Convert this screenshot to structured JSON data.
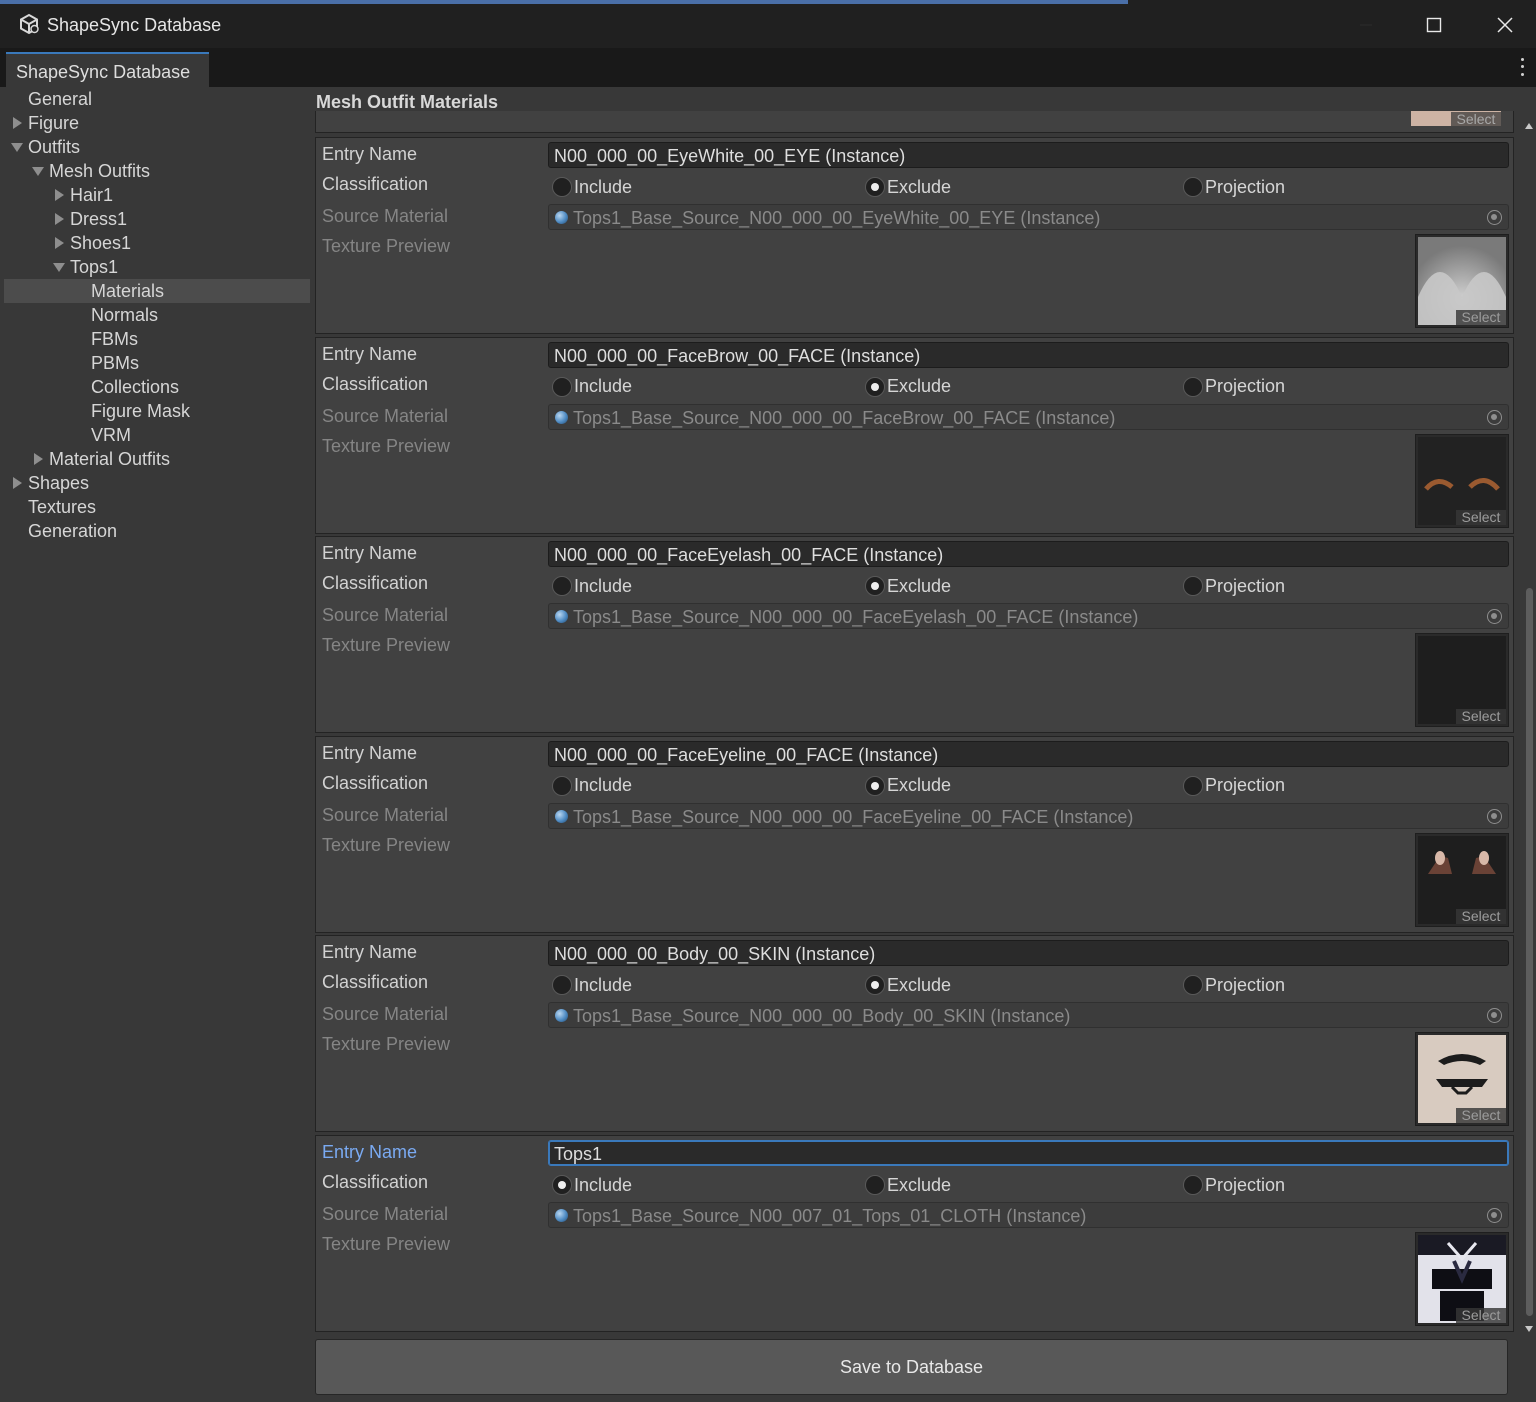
{
  "window": {
    "title": "ShapeSync Database"
  },
  "tab": {
    "label": "ShapeSync Database"
  },
  "sidebar": {
    "items": [
      {
        "label": "General",
        "depth": 0,
        "expander": "none"
      },
      {
        "label": "Figure",
        "depth": 0,
        "expander": "collapsed"
      },
      {
        "label": "Outfits",
        "depth": 0,
        "expander": "expanded"
      },
      {
        "label": "Mesh Outfits",
        "depth": 1,
        "expander": "expanded"
      },
      {
        "label": "Hair1",
        "depth": 2,
        "expander": "collapsed"
      },
      {
        "label": "Dress1",
        "depth": 2,
        "expander": "collapsed"
      },
      {
        "label": "Shoes1",
        "depth": 2,
        "expander": "collapsed"
      },
      {
        "label": "Tops1",
        "depth": 2,
        "expander": "expanded"
      },
      {
        "label": "Materials",
        "depth": 3,
        "expander": "none",
        "selected": true
      },
      {
        "label": "Normals",
        "depth": 3,
        "expander": "none"
      },
      {
        "label": "FBMs",
        "depth": 3,
        "expander": "none"
      },
      {
        "label": "PBMs",
        "depth": 3,
        "expander": "none"
      },
      {
        "label": "Collections",
        "depth": 3,
        "expander": "none"
      },
      {
        "label": "Figure Mask",
        "depth": 3,
        "expander": "none"
      },
      {
        "label": "VRM",
        "depth": 3,
        "expander": "none"
      },
      {
        "label": "Material Outfits",
        "depth": 1,
        "expander": "collapsed"
      },
      {
        "label": "Shapes",
        "depth": 0,
        "expander": "collapsed"
      },
      {
        "label": "Textures",
        "depth": 0,
        "expander": "none"
      },
      {
        "label": "Generation",
        "depth": 0,
        "expander": "none"
      }
    ]
  },
  "main": {
    "section_title": "Mesh Outfit Materials",
    "labels": {
      "entry_name": "Entry Name",
      "classification": "Classification",
      "source_material": "Source Material",
      "texture_preview": "Texture Preview"
    },
    "radio_options": [
      "Include",
      "Exclude",
      "Projection"
    ],
    "select_label": "Select",
    "entries": [
      {
        "entry_name": "N00_000_00_EyeWhite_00_EYE (Instance)",
        "classification": "Exclude",
        "source_material": "Tops1_Base_Source_N00_000_00_EyeWhite_00_EYE (Instance)",
        "preview": "eye-white-icon"
      },
      {
        "entry_name": "N00_000_00_FaceBrow_00_FACE (Instance)",
        "classification": "Exclude",
        "source_material": "Tops1_Base_Source_N00_000_00_FaceBrow_00_FACE (Instance)",
        "preview": "face-brow-icon"
      },
      {
        "entry_name": "N00_000_00_FaceEyelash_00_FACE (Instance)",
        "classification": "Exclude",
        "source_material": "Tops1_Base_Source_N00_000_00_FaceEyelash_00_FACE (Instance)",
        "preview": "face-eyelash-icon"
      },
      {
        "entry_name": "N00_000_00_FaceEyeline_00_FACE (Instance)",
        "classification": "Exclude",
        "source_material": "Tops1_Base_Source_N00_000_00_FaceEyeline_00_FACE (Instance)",
        "preview": "face-eyeline-icon"
      },
      {
        "entry_name": "N00_000_00_Body_00_SKIN (Instance)",
        "classification": "Exclude",
        "source_material": "Tops1_Base_Source_N00_000_00_Body_00_SKIN (Instance)",
        "preview": "body-skin-icon"
      },
      {
        "entry_name": "Tops1",
        "classification": "Include",
        "source_material": "Tops1_Base_Source_N00_007_01_Tops_01_CLOTH (Instance)",
        "preview": "tops-cloth-icon",
        "focused": true
      }
    ],
    "save_button": "Save to Database"
  },
  "colors": {
    "accent": "#3a79bb",
    "focused_label": "#7aaaf2",
    "panel": "#414141",
    "background": "#383838"
  }
}
